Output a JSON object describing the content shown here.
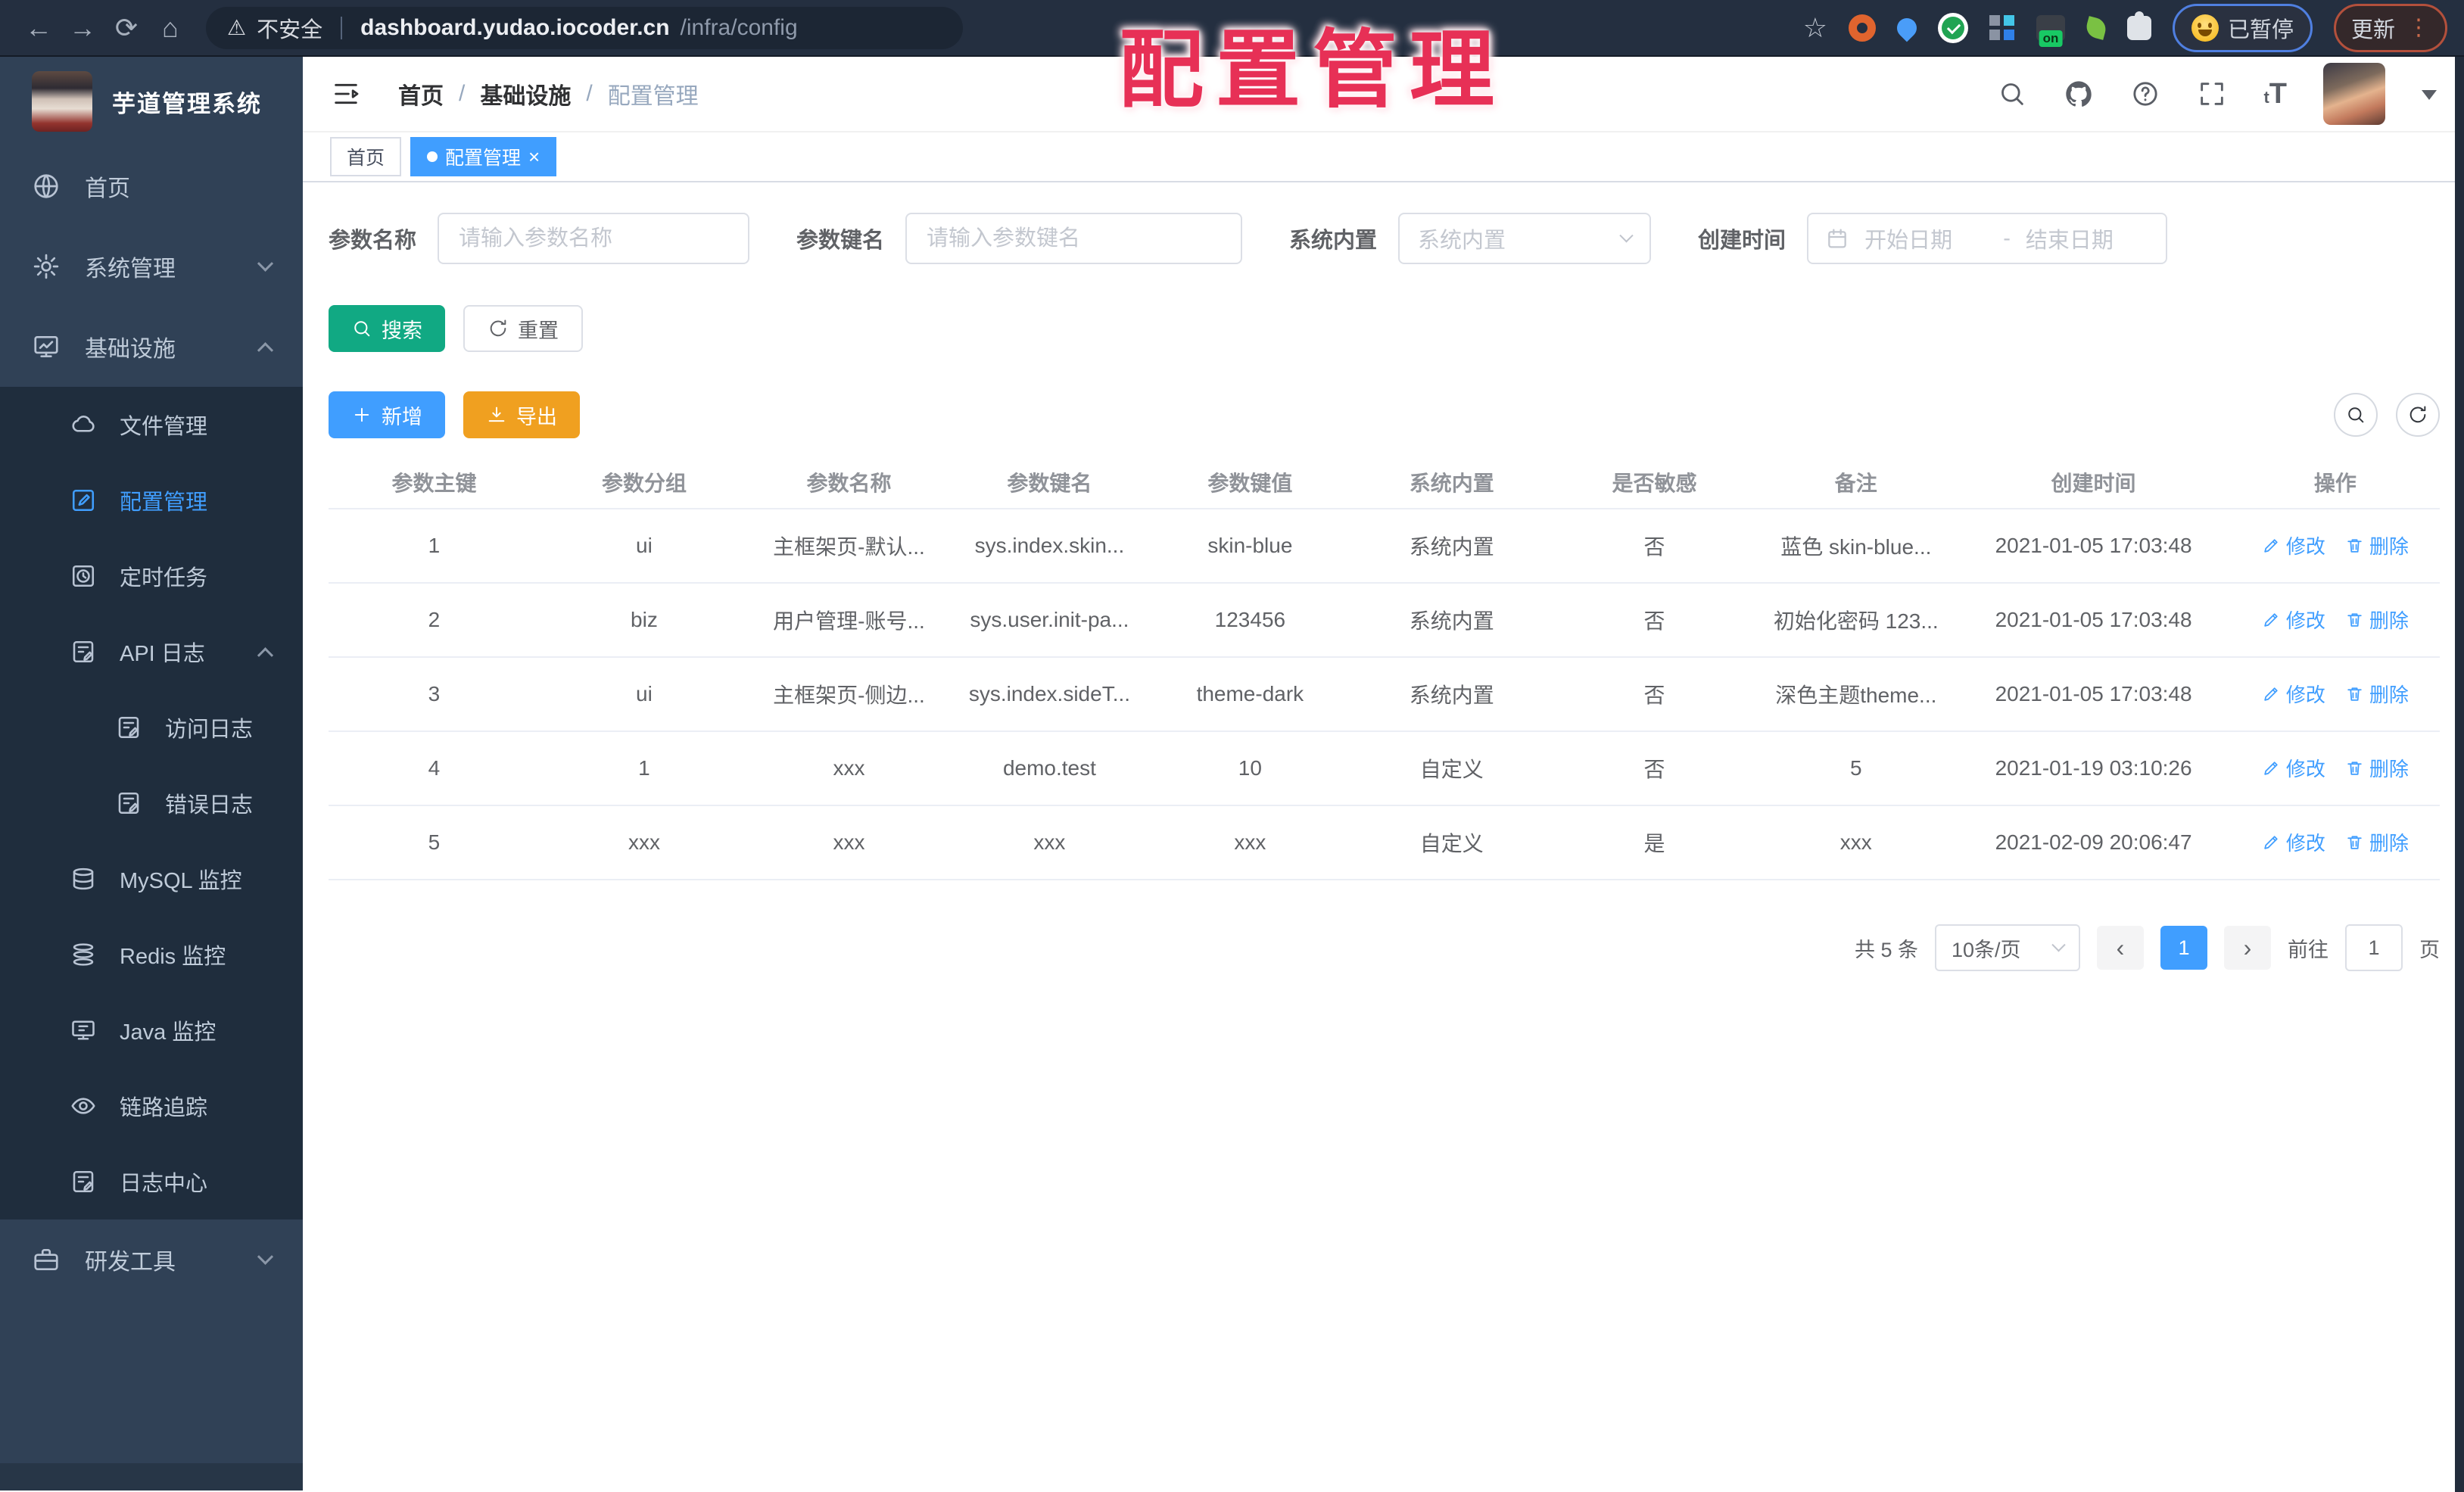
{
  "colors": {
    "accent": "#409EFF",
    "search_button": "#11A983",
    "export_button": "#F0A020",
    "sidebar_bg": "#304156",
    "submenu_bg": "#1F2D3D",
    "stamp_red": "#E73056",
    "browser_bar": "#242F40"
  },
  "overlay": {
    "stamp_text": "配置管理"
  },
  "icons": {
    "back": "←",
    "forward": "→",
    "reload": "⟳",
    "home": "⌂",
    "warning": "⚠",
    "star": "☆",
    "overflow": "⋮",
    "prev": "‹",
    "next": "›",
    "close": "×",
    "font_large": "T",
    "font_small": "t"
  },
  "browser": {
    "security_label": "不安全",
    "url_host": "dashboard.yudao.iocoder.cn",
    "url_path": "/infra/config",
    "paused_badge": "已暂停",
    "update_button": "更新",
    "ext_on_badge": "on"
  },
  "sidebar": {
    "logo_title": "芋道管理系统",
    "home": "首页",
    "system": "系统管理",
    "infra": "基础设施",
    "sub": {
      "file": "文件管理",
      "config": "配置管理",
      "job": "定时任务",
      "api_log": "API 日志",
      "access_log": "访问日志",
      "error_log": "错误日志",
      "mysql": "MySQL 监控",
      "redis": "Redis 监控",
      "java": "Java 监控",
      "trace": "链路追踪",
      "log_center": "日志中心"
    },
    "dev_tools": "研发工具"
  },
  "header": {
    "breadcrumb": {
      "home": "首页",
      "sep": "/",
      "section": "基础设施",
      "current": "配置管理"
    }
  },
  "tabs": {
    "home": "首页",
    "current": "配置管理"
  },
  "filters": {
    "name_label": "参数名称",
    "name_placeholder": "请输入参数名称",
    "key_label": "参数键名",
    "key_placeholder": "请输入参数键名",
    "type_label": "系统内置",
    "type_placeholder": "系统内置",
    "date_label": "创建时间",
    "date_start": "开始日期",
    "date_sep": "-",
    "date_end": "结束日期"
  },
  "toolbar": {
    "search": "搜索",
    "reset": "重置",
    "add": "新增",
    "export": "导出"
  },
  "table": {
    "headers": [
      "参数主键",
      "参数分组",
      "参数名称",
      "参数键名",
      "参数键值",
      "系统内置",
      "是否敏感",
      "备注",
      "创建时间",
      "操作"
    ],
    "rows": [
      [
        "1",
        "ui",
        "主框架页-默认...",
        "sys.index.skin...",
        "skin-blue",
        "系统内置",
        "否",
        "蓝色 skin-blue...",
        "2021-01-05 17:03:48"
      ],
      [
        "2",
        "biz",
        "用户管理-账号...",
        "sys.user.init-pa...",
        "123456",
        "系统内置",
        "否",
        "初始化密码 123...",
        "2021-01-05 17:03:48"
      ],
      [
        "3",
        "ui",
        "主框架页-侧边...",
        "sys.index.sideT...",
        "theme-dark",
        "系统内置",
        "否",
        "深色主题theme...",
        "2021-01-05 17:03:48"
      ],
      [
        "4",
        "1",
        "xxx",
        "demo.test",
        "10",
        "自定义",
        "否",
        "5",
        "2021-01-19 03:10:26"
      ],
      [
        "5",
        "xxx",
        "xxx",
        "xxx",
        "xxx",
        "自定义",
        "是",
        "xxx",
        "2021-02-09 20:06:47"
      ]
    ],
    "actions": {
      "edit": "修改",
      "delete": "删除"
    }
  },
  "pagination": {
    "total": "共 5 条",
    "page_size": "10条/页",
    "page": "1",
    "goto_label": "前往",
    "goto_value": "1",
    "page_unit": "页"
  }
}
